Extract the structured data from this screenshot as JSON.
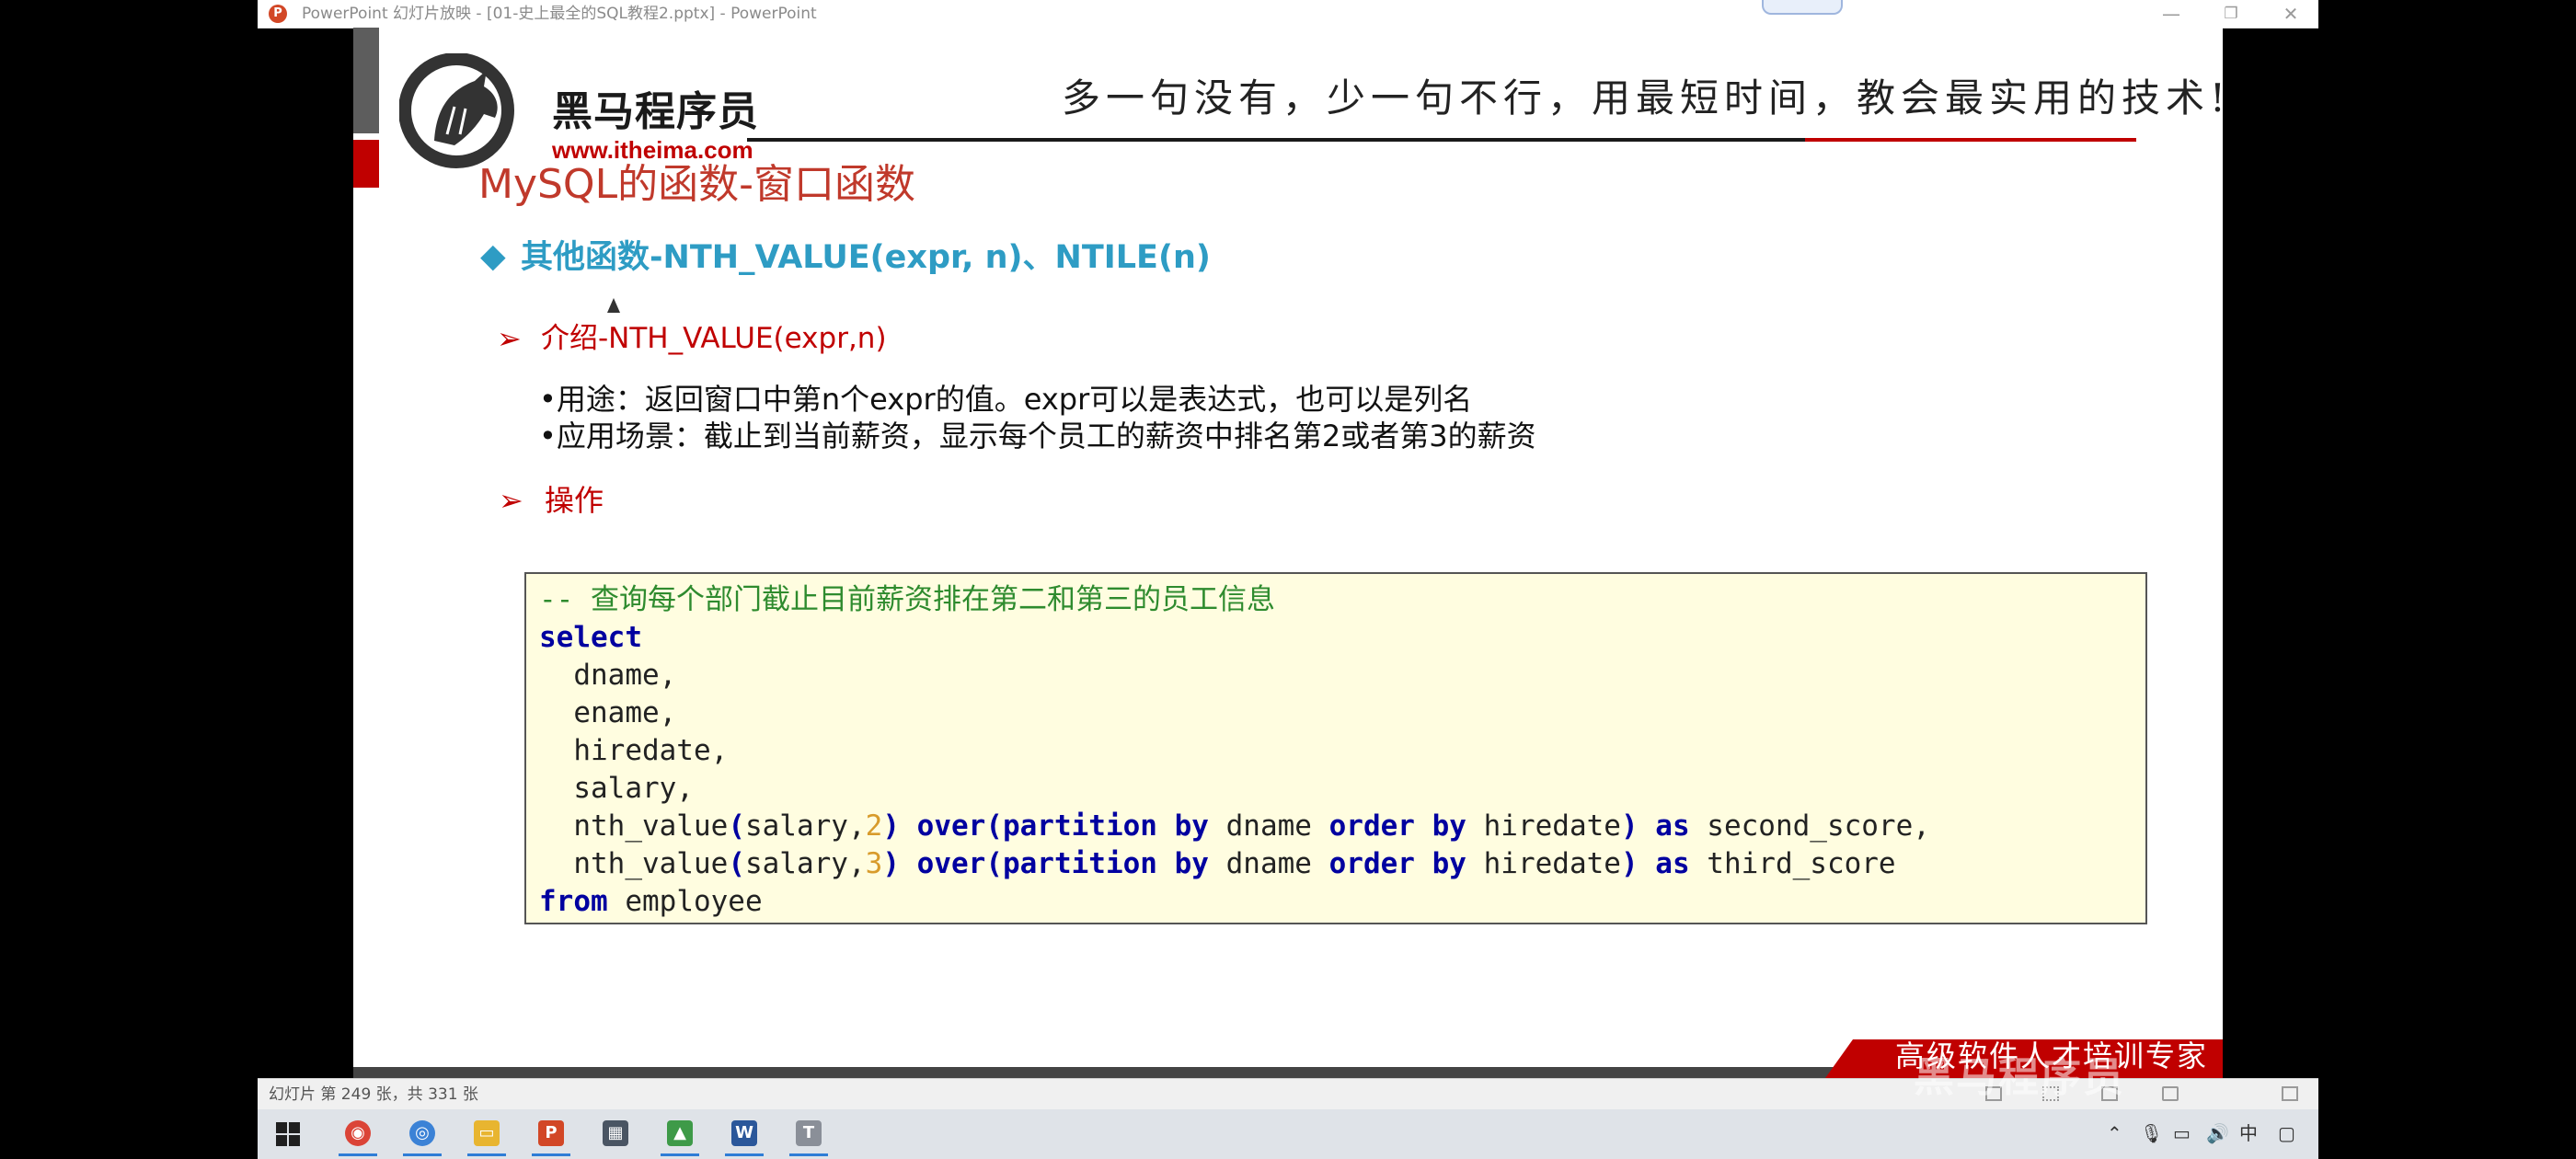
{
  "window": {
    "title": "PowerPoint 幻灯片放映 - [01-史上最全的SQL教程2.pptx] - PowerPoint",
    "app_icon": "powerpoint-icon",
    "controls": {
      "minimize": "—",
      "restore": "❐",
      "close": "✕"
    }
  },
  "slide": {
    "logo_text": "黑马程序员",
    "logo_url": "www.itheima.com",
    "slogan": "多一句没有，少一句不行，用最短时间，教会最实用的技术!",
    "title": "MySQL的函数-窗口函数",
    "section_bullet": "◆",
    "section_title": "其他函数-NTH_VALUE(expr, n)、NTILE(n)",
    "arrow": "➢",
    "intro_heading": "介绍-NTH_VALUE(expr,n)",
    "desc_usage": "•用途：返回窗口中第n个expr的值。expr可以是表达式，也可以是列名",
    "desc_scene": "•应用场景：截止到当前薪资，显示每个员工的薪资中排名第2或者第3的薪资",
    "ops_heading": "操作",
    "code": {
      "comment": "-- 查询每个部门截止目前薪资排在第二和第三的员工信息",
      "kw_select": "select",
      "col_dname": "  dname,",
      "col_ename": "  ename,",
      "col_hiredate": "  hiredate,",
      "col_salary": "  salary,",
      "fn_nth": "  nth_value",
      "paren_open": "(",
      "arg_salary": "salary,",
      "num2": "2",
      "num3": "3",
      "paren_close": ")",
      "kw_over": "over",
      "kw_partition": "partition",
      "kw_by": "by",
      "id_dname": "dname",
      "kw_order": "order",
      "id_hiredate": "hiredate",
      "kw_as": "as",
      "alias_second": "second_score,",
      "alias_third": "third_score",
      "kw_from": "from",
      "table": "employee"
    },
    "tagline": "高级软件人才培训专家"
  },
  "statusbar": {
    "slide_counter": "幻灯片 第 249 张，共 331 张"
  },
  "watermark": "黑马程序员",
  "taskbar": {
    "apps": [
      {
        "name": "chrome-icon",
        "glyph": "◉",
        "color": "#db4437"
      },
      {
        "name": "browser-icon",
        "glyph": "◎",
        "color": "#3b82d6"
      },
      {
        "name": "file-explorer-icon",
        "glyph": "▭",
        "color": "#e8b530"
      },
      {
        "name": "powerpoint-icon",
        "glyph": "P",
        "color": "#d24726"
      },
      {
        "name": "calculator-icon",
        "glyph": "▦",
        "color": "#4a5563"
      },
      {
        "name": "chart-app-icon",
        "glyph": "▲",
        "color": "#3e9a48"
      },
      {
        "name": "word-icon",
        "glyph": "W",
        "color": "#2b579a"
      },
      {
        "name": "text-editor-icon",
        "glyph": "T",
        "color": "#8a8f98"
      }
    ],
    "tray": {
      "up": "⌃",
      "mic": "🎙",
      "battery": "▭",
      "volume": "🔊",
      "ime": "中",
      "notifications": "▢"
    }
  },
  "colors": {
    "title_red": "#c0392b",
    "section_blue": "#2e9cc4",
    "accent_red": "#c00000",
    "code_bg": "#fffde0",
    "keyword_blue": "#0000a0",
    "comment_green": "#2e8b2e",
    "number_orange": "#d89b2b"
  }
}
